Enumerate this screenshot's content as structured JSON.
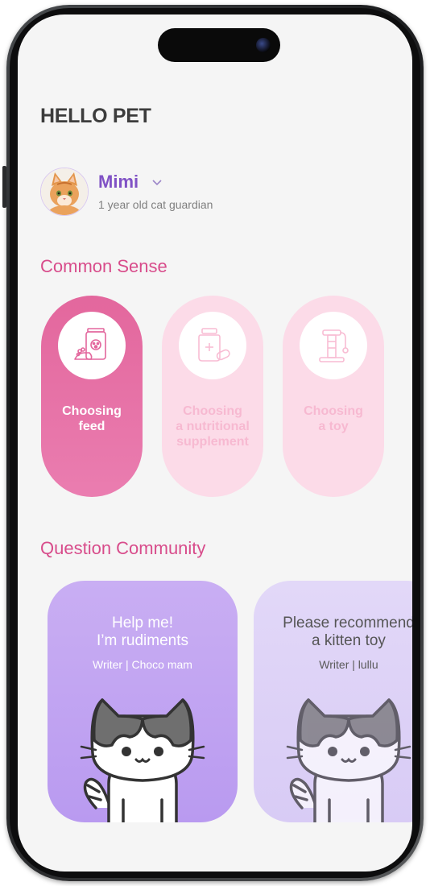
{
  "app": {
    "title": "HELLO PET"
  },
  "profile": {
    "name": "Mimi",
    "subtitle": "1 year old cat guardian",
    "dropdown_icon": "chevron-down-icon"
  },
  "common_sense": {
    "title": "Common Sense",
    "cards": [
      {
        "label": "Choosing\nfeed",
        "icon": "pet-food-bag-icon",
        "active": true
      },
      {
        "label": "Choosing\na nutritional\nsupplement",
        "icon": "supplement-bottle-icon",
        "active": false
      },
      {
        "label": "Choosing\na toy",
        "icon": "cat-tower-icon",
        "active": false
      }
    ]
  },
  "community": {
    "title": "Question Community",
    "posts": [
      {
        "title": "Help me!\nI’m rudiments",
        "writer": "Writer | Choco mam"
      },
      {
        "title": "Please recommend\na kitten toy",
        "writer": "Writer | lullu"
      }
    ]
  },
  "colors": {
    "accent_pink": "#d84c8b",
    "accent_purple": "#8052c5",
    "card_active": "#e3679d",
    "card_inactive": "#fcdbe8"
  }
}
